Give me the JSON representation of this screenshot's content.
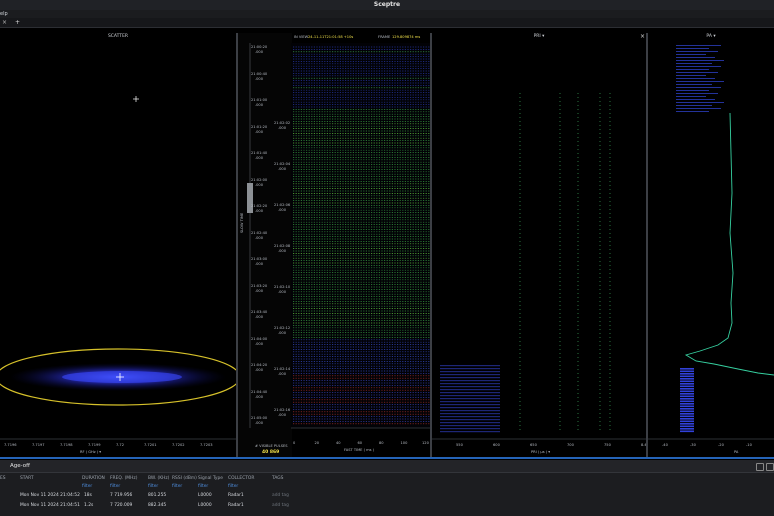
{
  "app": {
    "title": "Sceptre"
  },
  "menu": {
    "help": "elp"
  },
  "tabs": {
    "close_glyph": "×",
    "add_glyph": "+"
  },
  "scatter": {
    "title": "SCATTER",
    "x_ticks": [
      "7.7196",
      "7.7197",
      "7.7198",
      "7.7199",
      "7.72",
      "7.7201",
      "7.7202",
      "7.7203"
    ],
    "x_label": "RF ( GHz ) ▾"
  },
  "waterfall": {
    "in_view_label": "IN VIEW",
    "in_view_value": "24-11-11T21:01:58 +10s",
    "frame_label": "FRAME",
    "frame_value": "129.809874 ms",
    "y_label": "SLOW TIME",
    "time_ticks": [
      "21:00:20",
      "21:00:40",
      "21:01:00",
      "21:01:20",
      "21:01:40",
      "21:02:00",
      "21:02:20",
      "21:02:40",
      "21:03:00",
      "21:03:20",
      "21:03:40",
      "21:04:00",
      "21:04:20",
      "21:04:40",
      "21:05:00"
    ],
    "right_ticks": [
      "21:02:02",
      "21:02:04",
      "21:02:06",
      "21:02:08",
      "21:02:10",
      "21:02:12",
      "21:02:14",
      "21:02:16"
    ],
    "sub_label": ".000",
    "x_ticks": [
      "0",
      "20",
      "40",
      "60",
      "80",
      "100",
      "120"
    ],
    "x_label": "FAST TIME ( ms )",
    "pulses_label": "# VISIBLE PULSES",
    "pulses_value": "40 869"
  },
  "pri": {
    "title": "PRI ▾",
    "close_glyph": "×",
    "x_ticks": [
      "550",
      "600",
      "650",
      "700",
      "750",
      "8.40"
    ],
    "x_label": "PRI ( µs ) ▾"
  },
  "pa": {
    "title": "PA ▾",
    "x_ticks": [
      "-40",
      "-30",
      "-20",
      "-10"
    ],
    "x_label": "PA"
  },
  "ageoff": {
    "title": "Age-off",
    "columns": [
      "ES",
      "START",
      "DURATION",
      "FREQ. (MHz)",
      "BW. (KHz)",
      "RSSI (dBm)",
      "Signal Type",
      "COLLECTOR",
      "TAGS"
    ],
    "filters": [
      "filter",
      "filter",
      "filter",
      "filter",
      "filter",
      "filter"
    ],
    "rows": [
      {
        "start": "Mon Nov 11 2024 21:04:52",
        "duration": "18s",
        "freq": "7 719.956",
        "bw": "801.255",
        "signal": "L0000",
        "collector": "Radar1",
        "tags": "add tag"
      },
      {
        "start": "Mon Nov 11 2024 21:04:51",
        "duration": "1.2s",
        "freq": "7 720.009",
        "bw": "882.345",
        "signal": "L0000",
        "collector": "Radar1",
        "tags": "add tag"
      }
    ]
  }
}
